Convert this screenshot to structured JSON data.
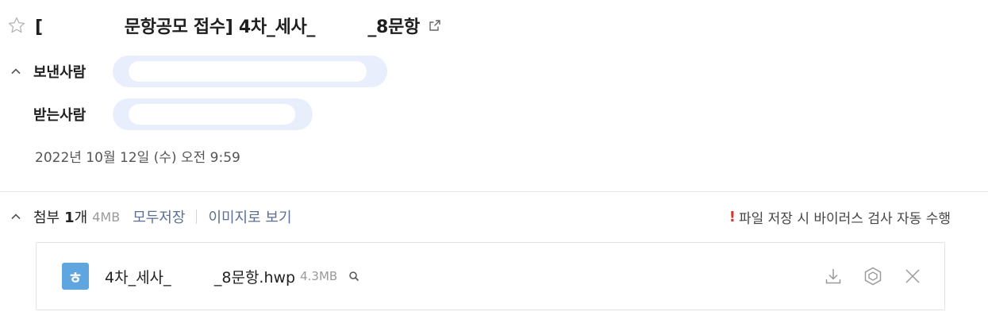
{
  "mail": {
    "subject": "[              문항공모 접수] 4차_세사_         _8문항",
    "sender_label": "보낸사람",
    "recipient_label": "받는사람",
    "date": "2022년 10월 12일 (수) 오전 9:59"
  },
  "attachments": {
    "title": "첨부",
    "count": "1",
    "count_unit": "개",
    "total_size": "4MB",
    "save_all": "모두저장",
    "view_images": "이미지로 보기",
    "notice_mark": "!",
    "notice": "파일 저장 시 바이러스 검사 자동 수행",
    "files": [
      {
        "icon_letter": "ㅎ",
        "name": "4차_세사_         _8문항.hwp",
        "size": "4.3MB"
      }
    ]
  },
  "icons": {
    "star": "star-outline-icon",
    "external": "open-external-icon",
    "chevron": "chevron-up-icon",
    "search": "search-icon",
    "download": "download-icon",
    "cloud": "cloud-save-icon",
    "close": "close-icon"
  },
  "colors": {
    "accent_link": "#5b6e96",
    "pill_bg": "#e8eefb",
    "hwp_icon": "#5fa5e0",
    "notice_mark": "#e0312b"
  }
}
